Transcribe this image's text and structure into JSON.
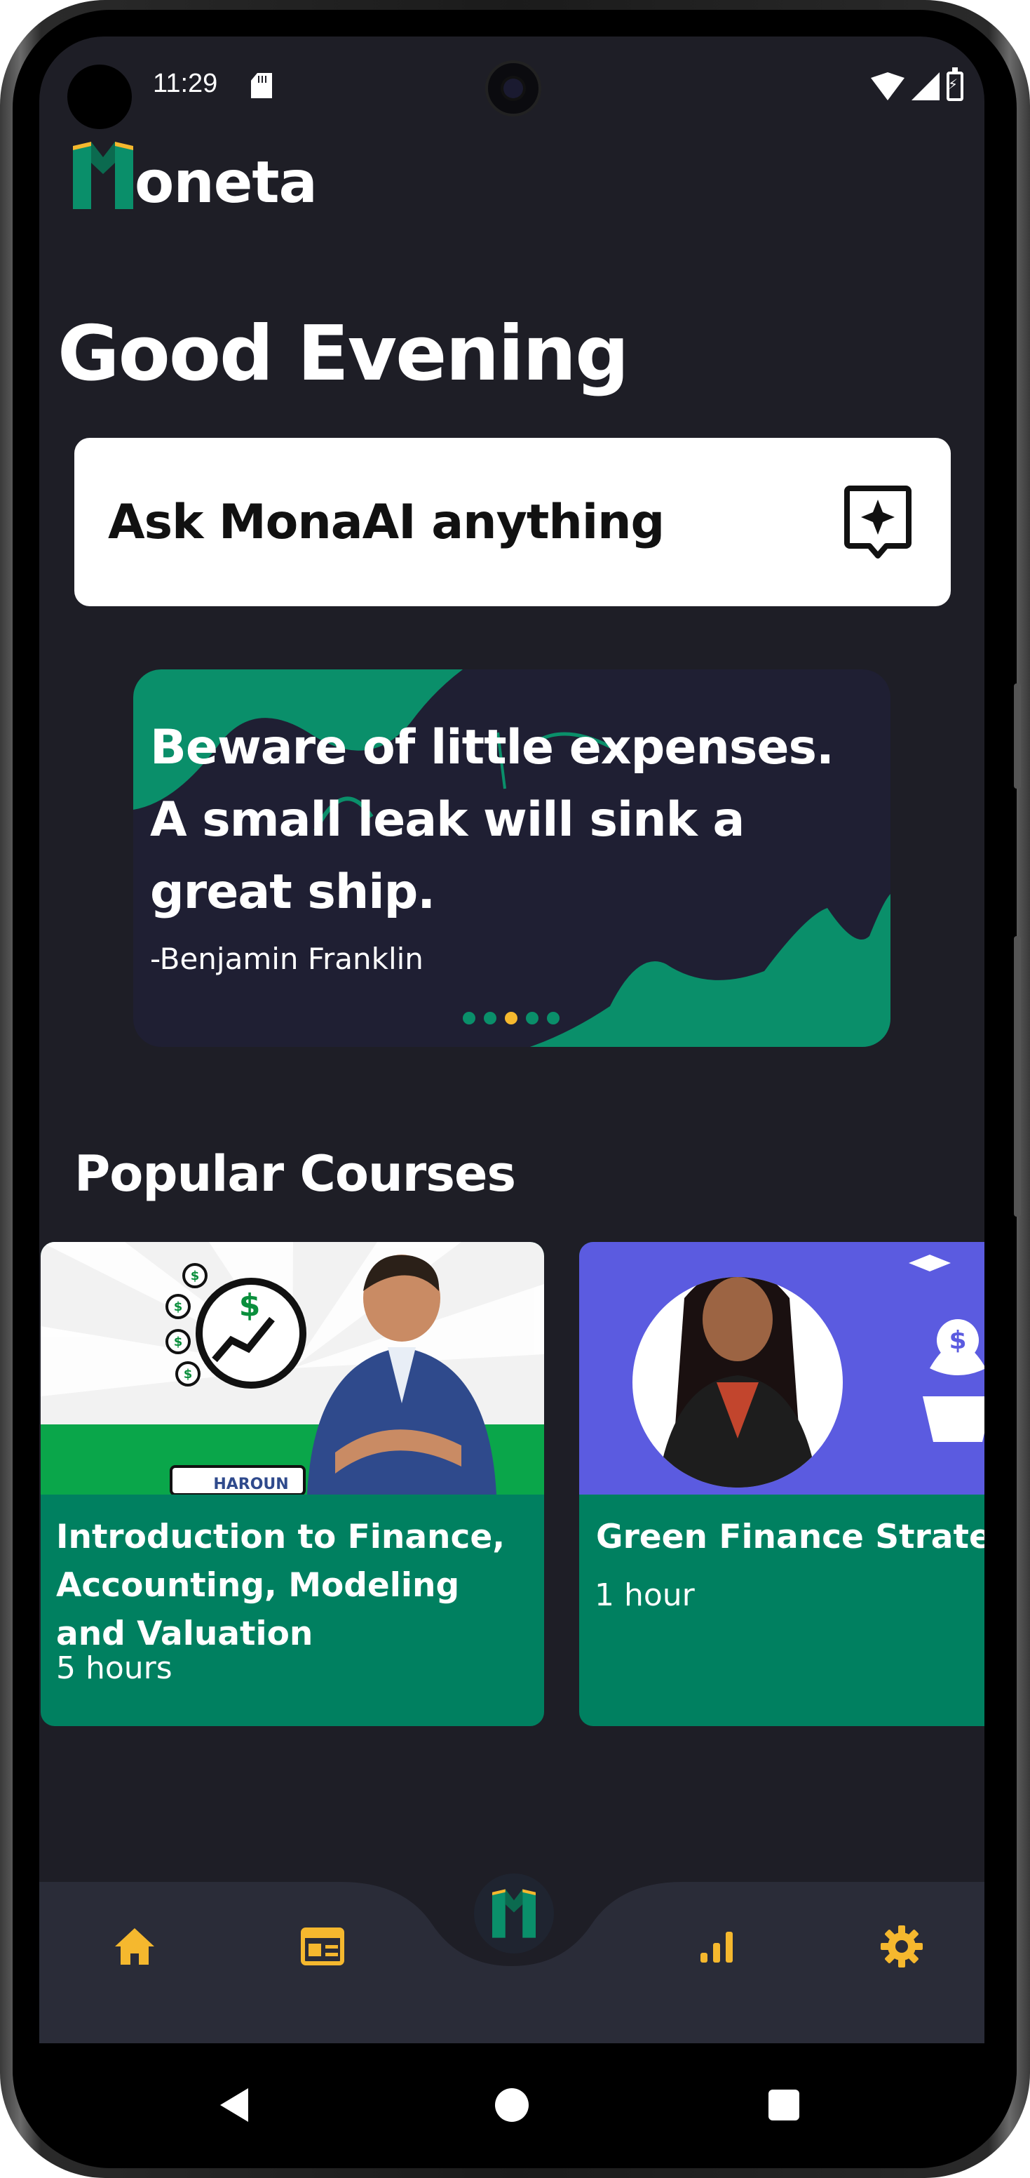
{
  "status_bar": {
    "time": "11:29",
    "icons": [
      "sd-card-icon",
      "wifi-icon",
      "signal-icon",
      "battery-charging-icon"
    ]
  },
  "app": {
    "logo_text": "oneta",
    "brand_color": "#0A8F6A"
  },
  "greeting": "Good Evening",
  "ask": {
    "label": "Ask MonaAI anything",
    "icon": "sparkle-chat-icon"
  },
  "quote_carousel": {
    "quote": "Beware of little expenses. A small leak will sink a great ship.",
    "author": "-Benjamin Franklin",
    "page_count": 5,
    "active_index": 2,
    "active_dot_color": "#F5B82E"
  },
  "popular_courses": {
    "title": "Popular Courses",
    "courses": [
      {
        "title": "Introduction to Finance, Accounting, Modeling and Valuation",
        "duration": "5 hours",
        "thumb_text": "HAROUN"
      },
      {
        "title": "Green Finance Strateg",
        "duration": "1 hour"
      }
    ]
  },
  "bottom_nav": {
    "items": [
      "home-icon",
      "news-icon",
      "moneta-logo-icon",
      "stats-icon",
      "settings-icon"
    ],
    "icon_color": "#F5B82E"
  },
  "system_nav": [
    "back-button",
    "home-button",
    "recents-button"
  ]
}
